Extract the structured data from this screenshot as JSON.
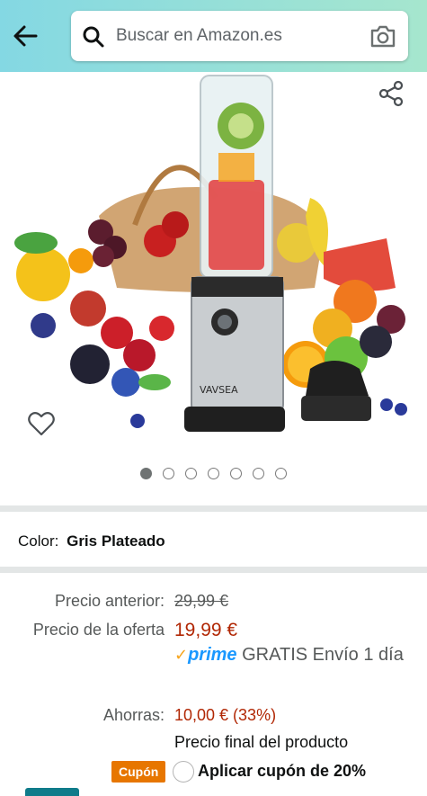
{
  "header": {
    "search_placeholder": "Buscar en Amazon.es",
    "back_icon": "arrow-left-icon",
    "search_icon": "search-icon",
    "camera_icon": "camera-icon",
    "gradient_colors": [
      "#84d8e3",
      "#a6e6ce"
    ]
  },
  "gallery": {
    "brand_text": "VAVSEA",
    "image_count": 7,
    "active_index": 0,
    "share_icon": "share-icon",
    "wishlist_icon": "heart-outline-icon"
  },
  "color": {
    "label": "Color:",
    "value": "Gris Plateado"
  },
  "pricing": {
    "previous_label": "Precio anterior:",
    "previous_value": "29,99 €",
    "deal_label": "Precio de la oferta",
    "deal_value": "19,99 €",
    "prime_check": "✓",
    "prime_word": "prime",
    "shipping_text": "GRATIS Envío 1 día",
    "savings_label": "Ahorras:",
    "savings_value": "10,00 € (33%)",
    "final_note": "Precio final del producto",
    "accent_color": "#b12704"
  },
  "coupon": {
    "badge": "Cupón",
    "text": "Aplicar cupón de 20%",
    "badge_color": "#e77600"
  }
}
